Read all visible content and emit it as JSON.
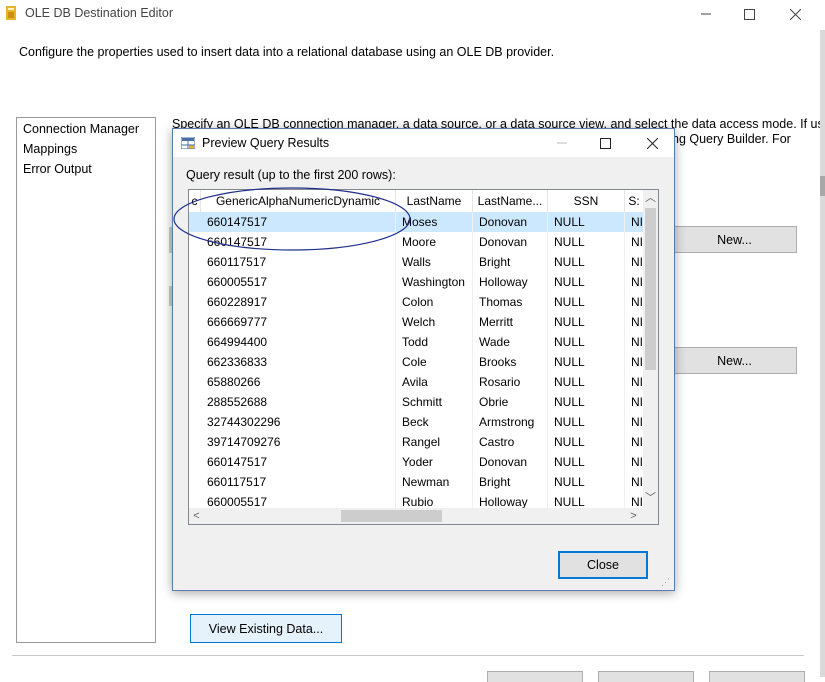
{
  "main": {
    "title": "OLE DB Destination Editor",
    "description": "Configure the properties used to insert data into a relational database using an OLE DB provider.",
    "nav_items": [
      "Connection Manager",
      "Mappings",
      "Error Output"
    ],
    "behind_text_line1": "Specify an OLE DB connection manager, a data source, or a data source view, and select the data access mode. If using",
    "behind_text_line2": "ng Query Builder. For",
    "new_button_label": "New...",
    "view_existing_label": "View Existing Data..."
  },
  "dialog": {
    "title": "Preview Query Results",
    "query_label": "Query result (up to the first 200 rows):",
    "close_label": "Close",
    "columns": [
      "c",
      "GenericAlphaNumericDynamic",
      "LastName",
      "LastName...",
      "SSN",
      "S:"
    ],
    "rows": [
      [
        "660147517",
        "Moses",
        "Donovan",
        "NULL",
        "NI"
      ],
      [
        "660147517",
        "Moore",
        "Donovan",
        "NULL",
        "NI"
      ],
      [
        "660117517",
        "Walls",
        "Bright",
        "NULL",
        "NI"
      ],
      [
        "660005517",
        "Washington",
        "Holloway",
        "NULL",
        "NI"
      ],
      [
        "660228917",
        "Colon",
        "Thomas",
        "NULL",
        "NI"
      ],
      [
        "666669777",
        "Welch",
        "Merritt",
        "NULL",
        "NI"
      ],
      [
        "664994400",
        "Todd",
        "Wade",
        "NULL",
        "NI"
      ],
      [
        "662336833",
        "Cole",
        "Brooks",
        "NULL",
        "NI"
      ],
      [
        "65880266",
        "Avila",
        "Rosario",
        "NULL",
        "NI"
      ],
      [
        "288552688",
        "Schmitt",
        "Obrie",
        "NULL",
        "NI"
      ],
      [
        "32744302296",
        "Beck",
        "Armstrong",
        "NULL",
        "NI"
      ],
      [
        "39714709276",
        "Rangel",
        "Castro",
        "NULL",
        "NI"
      ],
      [
        "660147517",
        "Yoder",
        "Donovan",
        "NULL",
        "NI"
      ],
      [
        "660117517",
        "Newman",
        "Bright",
        "NULL",
        "NI"
      ],
      [
        "660005517",
        "Rubio",
        "Holloway",
        "NULL",
        "NI"
      ]
    ],
    "selected_row": 0
  },
  "icons": {
    "minimize": "minimize-icon",
    "maximize": "maximize-icon",
    "close": "close-icon"
  },
  "colors": {
    "selection": "#cce8ff",
    "accent_blue": "#0078d7",
    "annotation_ellipse": "#1f2f8a"
  }
}
